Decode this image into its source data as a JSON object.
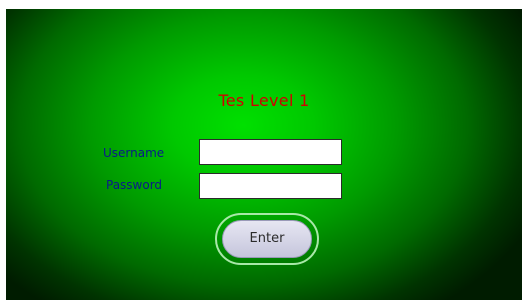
{
  "title": "Tes Level 1",
  "form": {
    "username_label": "Username",
    "username_value": "",
    "password_label": "Password",
    "password_value": "",
    "enter_label": "Enter"
  },
  "colors": {
    "background_center": "#00e000",
    "background_edge": "#001c00",
    "title": "#d10000",
    "labels": "#0a1a8a",
    "button_ring": "#a8e8a8",
    "button_face": "#d6d6e8"
  }
}
